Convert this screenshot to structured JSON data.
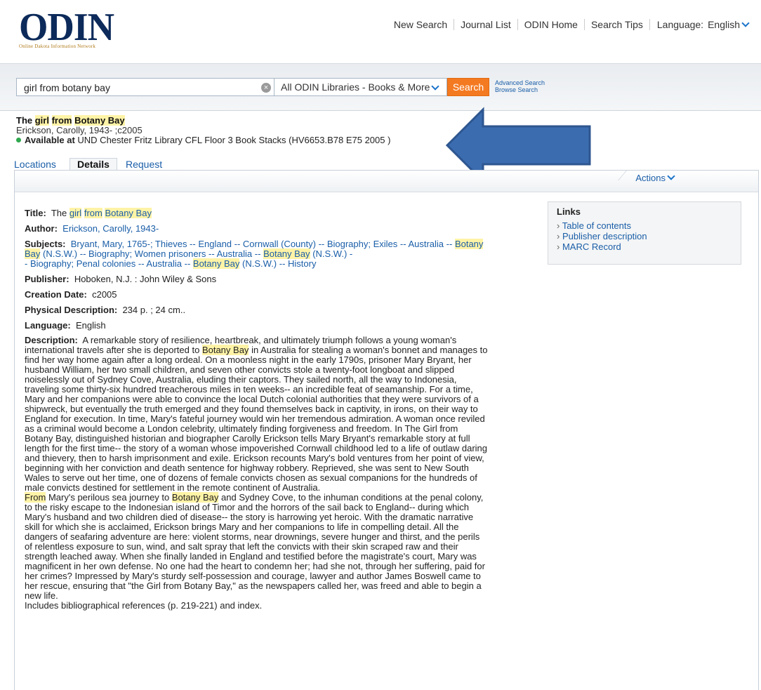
{
  "header": {
    "logo_text": "ODIN",
    "logo_subtitle": "Online Dakota Information Network",
    "nav": [
      "New Search",
      "Journal List",
      "ODIN Home",
      "Search Tips"
    ],
    "language_label": "Language:",
    "language_value": "English"
  },
  "search": {
    "query": "girl from botany bay",
    "scope": "All ODIN Libraries - Books & More",
    "button": "Search",
    "advanced": "Advanced Search",
    "browse": "Browse Search"
  },
  "brief": {
    "title_pre": "The ",
    "title_hl1": "girl",
    "title_mid1": " ",
    "title_hl2": "from",
    "title_mid2": " ",
    "title_hl3": "Botany Bay",
    "author": "Erickson, Carolly, 1943- ;c2005",
    "available_label": "Available at",
    "available_location": "UND Chester Fritz Library CFL Floor 3 Book Stacks (HV6653.B78 E75 2005 )"
  },
  "tabs": [
    "Locations",
    "Details",
    "Request"
  ],
  "actions_label": "Actions",
  "details": {
    "title_label": "Title:",
    "title_pre": "The",
    "author_label": "Author:",
    "author_value": "Erickson, Carolly, 1943-",
    "subjects_label": "Subjects:",
    "subjects": {
      "s1": "Bryant, Mary, 1765-; Thieves -- England -- Cornwall (County) -- Biography; Exiles --",
      "s2": "Australia --",
      "s3": "(N.S.W.) -- Biography; Women prisoners -- Australia --",
      "s4": "(N.S.W.) -",
      "s5": "- Biography; Penal colonies -- Australia --",
      "s6": "(N.S.W.) -- History"
    },
    "publisher_label": "Publisher:",
    "publisher_value": "Hoboken, N.J. : John Wiley & Sons",
    "creation_label": "Creation Date:",
    "creation_value": "c2005",
    "physical_label": "Physical Description:",
    "physical_value": "234 p. ; 24 cm..",
    "language_label": "Language:",
    "language_value": "English",
    "description_label": "Description:",
    "desc_p1a": "A remarkable story of resilience, heartbreak, and ultimately triumph follows a young woman's international travels after she is deported to",
    "desc_p1b": "in Australia for stealing a woman's bonnet and manages to find her way home again after a long ordeal. On a moonless night in the early 1790s, prisoner Mary Bryant, her husband William, her two small children, and seven other convicts stole a twenty-foot longboat and slipped noiselessly out of Sydney Cove, Australia, eluding their captors. They sailed north, all the way to Indonesia, traveling some thirty-six hundred treacherous miles in ten weeks-- an incredible feat of seamanship. For a time, Mary and her companions were able to convince the local Dutch colonial authorities that they were survivors of a shipwreck, but eventually the truth emerged and they found themselves back in captivity, in irons, on their way to England for execution. In time, Mary's fateful journey would win her tremendous admiration. A woman once reviled as a criminal would become a London celebrity, ultimately finding forgiveness and freedom. In The Girl from Botany Bay, distinguished historian and biographer Carolly Erickson tells Mary Bryant's remarkable story at full length for the first time-- the story of a woman whose impoverished Cornwall childhood led to a life of outlaw daring and thievery, then to harsh imprisonment and exile. Erickson recounts Mary's bold ventures from her point of view, beginning with her conviction and death sentence for highway robbery. Reprieved, she was sent to New South Wales to serve out her time, one of dozens of female convicts chosen as sexual companions for the hundreds of male convicts destined for settlement in the remote continent of Australia.",
    "desc_p2a": "Mary's perilous sea journey to",
    "desc_p2b": "and Sydney Cove, to the inhuman conditions at the penal colony, to the risky escape to the Indonesian island of Timor and the horrors of the sail back to England-- during which Mary's husband and two children died of disease-- the story is harrowing yet heroic. With the dramatic narrative skill for which she is acclaimed, Erickson brings Mary and her companions to life in compelling detail. All the dangers of seafaring adventure are here: violent storms, near drownings, severe hunger and thirst, and the perils of relentless exposure to sun, wind, and salt spray that left the convicts with their skin scraped raw and their strength leached away. When she finally landed in England and testified before the magistrate's court, Mary was magnificent in her own defense. No one had the heart to condemn her; had she not, through her suffering, paid for her crimes? Impressed by Mary's sturdy self-possession and courage, lawyer and author James Boswell came to her rescue, ensuring that \"the Girl from Botany Bay,\" as the newspapers called her, was freed and able to begin a new life.",
    "desc_p3": "Includes bibliographical references (p. 219-221) and index."
  },
  "links": {
    "heading": "Links",
    "items": [
      "Table of contents",
      "Publisher description",
      "MARC Record"
    ]
  },
  "colors": {
    "accent": "#f47a21",
    "link": "#1a5ea8",
    "arrow": "#3b6cb0",
    "available": "#2fa84f"
  }
}
